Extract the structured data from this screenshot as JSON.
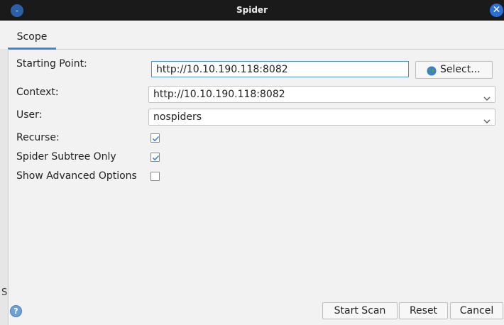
{
  "window": {
    "title": "Spider",
    "close_glyph": "✕"
  },
  "tabs": [
    {
      "label": "Scope"
    }
  ],
  "form": {
    "starting_point": {
      "label": "Starting Point:",
      "value": "http://10.10.190.118:8082",
      "select_button": "Select..."
    },
    "context": {
      "label": "Context:",
      "value": "http://10.10.190.118:8082"
    },
    "user": {
      "label": "User:",
      "value": "nospiders"
    },
    "recurse": {
      "label": "Recurse:",
      "checked": true
    },
    "spider_subtree_only": {
      "label": "Spider Subtree Only",
      "checked": true
    },
    "show_advanced_options": {
      "label": "Show Advanced Options",
      "checked": false
    }
  },
  "footer": {
    "help_glyph": "?",
    "start_scan": "Start Scan",
    "reset": "Reset",
    "cancel": "Cancel",
    "side_text": "S"
  },
  "colors": {
    "titlebar": "#1a1a1a",
    "accent": "#3d86d8",
    "close_button": "#2a6fd8"
  },
  "icons": {
    "app": "zap-app-icon",
    "close": "close-icon",
    "globe": "globe-icon",
    "dropdown": "chevron-down-icon",
    "check": "checkmark-icon",
    "help": "help-icon"
  }
}
